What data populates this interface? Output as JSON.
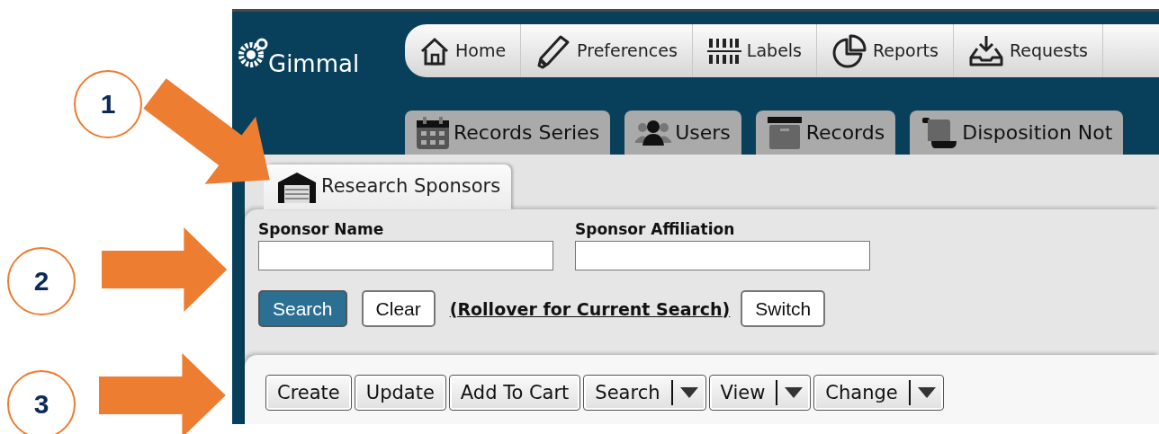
{
  "annotations": [
    {
      "label": "1"
    },
    {
      "label": "2"
    },
    {
      "label": "3"
    }
  ],
  "logo": {
    "text": "Gimmal"
  },
  "main_nav": [
    {
      "label": "Home",
      "kind": "home"
    },
    {
      "label": "Preferences",
      "kind": "pencil"
    },
    {
      "label": "Labels",
      "kind": "barcode"
    },
    {
      "label": "Reports",
      "kind": "pie"
    },
    {
      "label": "Requests",
      "kind": "inbox"
    }
  ],
  "module_tabs": [
    {
      "label": "Records Series",
      "kind": "calendar",
      "selected": false
    },
    {
      "label": "Users",
      "kind": "users",
      "selected": false
    },
    {
      "label": "Records",
      "kind": "box",
      "selected": false
    },
    {
      "label": "Disposition Not",
      "kind": "scroll",
      "selected": false
    }
  ],
  "sub_tabs": [
    {
      "label": "Research Sponsors",
      "selected": true
    }
  ],
  "search_form": {
    "fields": [
      {
        "label": "Sponsor Name"
      },
      {
        "label": "Sponsor Affiliation"
      }
    ],
    "buttons": [
      {
        "label": "Search",
        "primary": true
      },
      {
        "label": "Clear",
        "primary": false
      }
    ],
    "rollover_link": "(Rollover for Current Search)",
    "switch_button": "Switch"
  },
  "toolbar": [
    {
      "label": "Create",
      "dropdown": false
    },
    {
      "label": "Update",
      "dropdown": false
    },
    {
      "label": "Add To Cart",
      "dropdown": false
    },
    {
      "label": "Search",
      "dropdown": true
    },
    {
      "label": "View",
      "dropdown": true
    },
    {
      "label": "Change",
      "dropdown": true
    }
  ]
}
